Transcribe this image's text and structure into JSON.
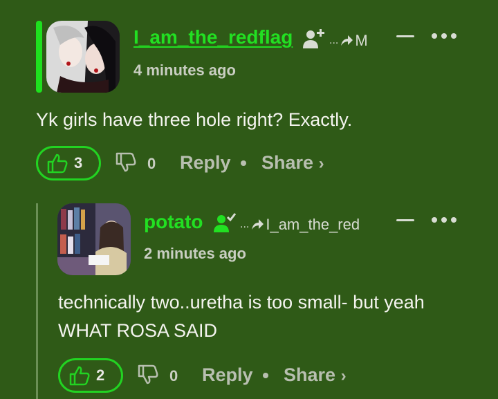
{
  "comments": [
    {
      "username": "I_am_the_redflag",
      "reply_to": "M",
      "timestamp": "4 minutes ago",
      "body": "Yk girls have three hole right? Exactly.",
      "upvotes": "3",
      "downvotes": "0",
      "reply_label": "Reply",
      "share_label": "Share",
      "share_chevron": "›",
      "reply_prefix": "...",
      "user_icon": "add-user-icon"
    },
    {
      "username": "potato",
      "reply_to": "I_am_the_red",
      "timestamp": "2 minutes ago",
      "body_line1": "technically two..uretha is too small- but yeah",
      "body_line2": "WHAT ROSA SAID",
      "upvotes": "2",
      "downvotes": "0",
      "reply_label": "Reply",
      "share_label": "Share",
      "share_chevron": "›",
      "reply_prefix": "...",
      "user_icon": "user-check-icon"
    }
  ],
  "colors": {
    "background": "#2f5a17",
    "accent": "#22e022",
    "muted": "#b8bfb0"
  }
}
